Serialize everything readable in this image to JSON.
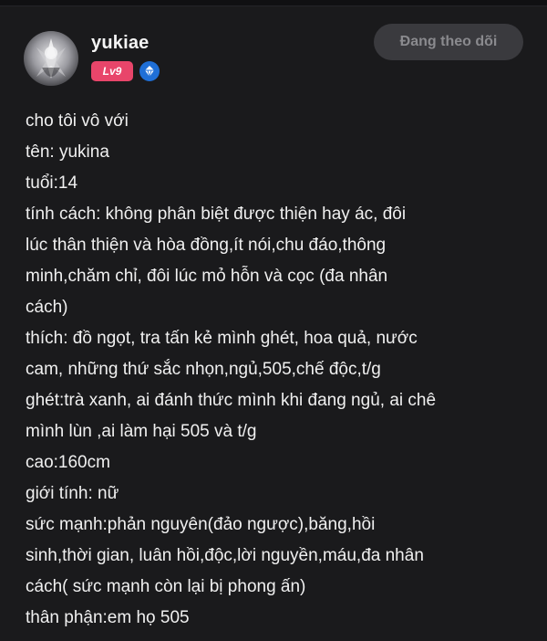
{
  "user": {
    "name": "yukiae",
    "level": "Lv9"
  },
  "follow_button": {
    "label": "Đang theo dõi"
  },
  "icons": {
    "avatar": "avatar-image",
    "verified": "verified-diamond-icon"
  },
  "colors": {
    "background": "#1a1a1c",
    "level_badge": "#e8456a",
    "verified_badge": "#1f6fd6",
    "follow_button_bg": "#3a3a3e",
    "follow_button_text": "#8a8a8e"
  },
  "post": {
    "lines": [
      "cho tôi vô với",
      "tên: yukina",
      "tuổi:14",
      "tính cách: không phân biệt được thiện hay ác, đôi",
      "lúc thân thiện và hòa đồng,ít nói,chu đáo,thông",
      "minh,chăm chỉ, đôi lúc mỏ hỗn và cọc (đa nhân",
      "cách)",
      "thích: đồ ngọt, tra tấn kẻ mình ghét, hoa quả, nước",
      "cam, những thứ sắc nhọn,ngủ,505,chế độc,t/g",
      "ghét:trà xanh, ai đánh thức mình khi đang ngủ, ai chê",
      "mình lùn ,ai làm hại 505 và t/g",
      "cao:160cm",
      "giới tính: nữ",
      "sức mạnh:phản nguyên(đảo ngược),băng,hồi",
      "sinh,thời gian, luân hồi,độc,lời nguyền,máu,đa nhân",
      "cách( sức mạnh còn lại bị phong ấn)",
      "thân phận:em họ 505"
    ]
  }
}
